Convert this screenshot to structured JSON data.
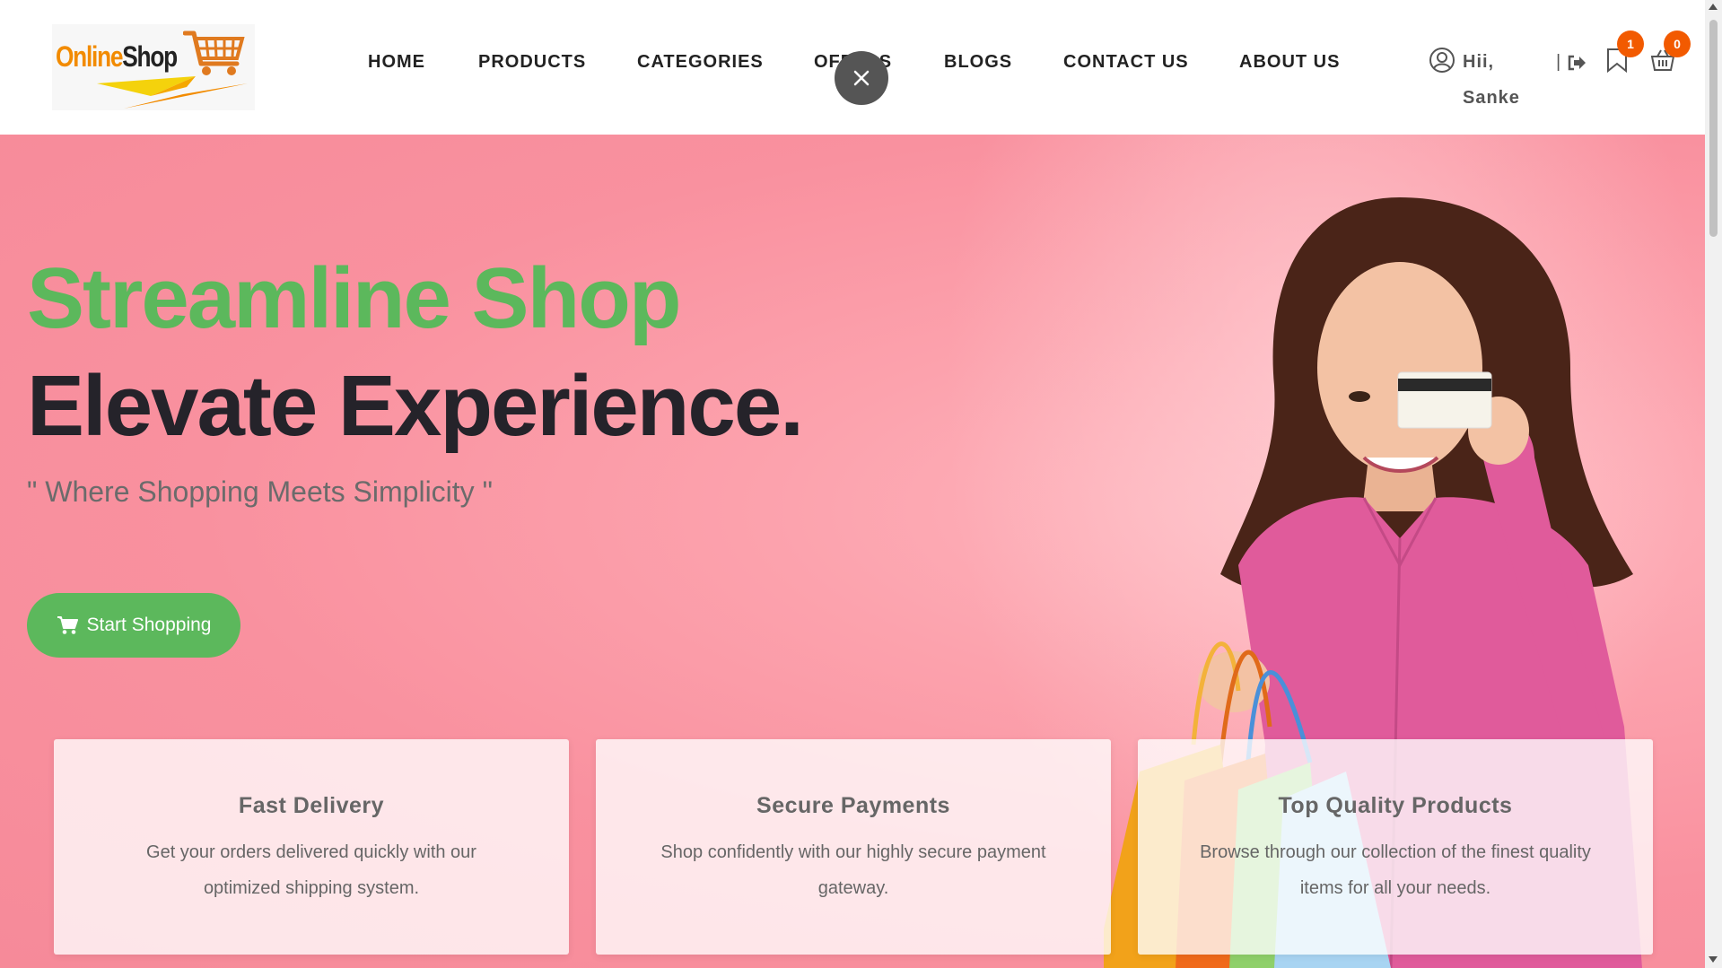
{
  "brand": {
    "word1": "Online",
    "word2": "Shop",
    "icon": "shopping-cart-logo"
  },
  "nav": {
    "items": [
      {
        "label": "HOME"
      },
      {
        "label": "PRODUCTS"
      },
      {
        "label": "CATEGORIES"
      },
      {
        "label": "OFFERS"
      },
      {
        "label": "BLOGS"
      },
      {
        "label": "CONTACT US"
      },
      {
        "label": "ABOUT US"
      }
    ]
  },
  "user": {
    "greeting": "Hii,",
    "name": "Sanke",
    "separator": "|",
    "wishlist_count": "1",
    "cart_count": "0"
  },
  "hero": {
    "headline_1": "Streamline Shop",
    "headline_2": "Elevate Experience.",
    "tagline": "\" Where Shopping Meets Simplicity \"",
    "cta_label": "Start Shopping"
  },
  "features": [
    {
      "title": "Fast Delivery",
      "text": "Get your orders delivered quickly with our optimized shipping system."
    },
    {
      "title": "Secure Payments",
      "text": "Shop confidently with our highly secure payment gateway."
    },
    {
      "title": "Top Quality Products",
      "text": "Browse through our collection of the finest quality items for all your needs."
    }
  ],
  "colors": {
    "accent_green": "#5cb85c",
    "badge_orange": "#f25a00",
    "hero_pink": "#f9919f",
    "heading_dark": "#25232a"
  },
  "icons": [
    "user-circle-icon",
    "logout-icon",
    "bookmark-icon",
    "basket-icon",
    "close-icon",
    "cart-icon"
  ]
}
